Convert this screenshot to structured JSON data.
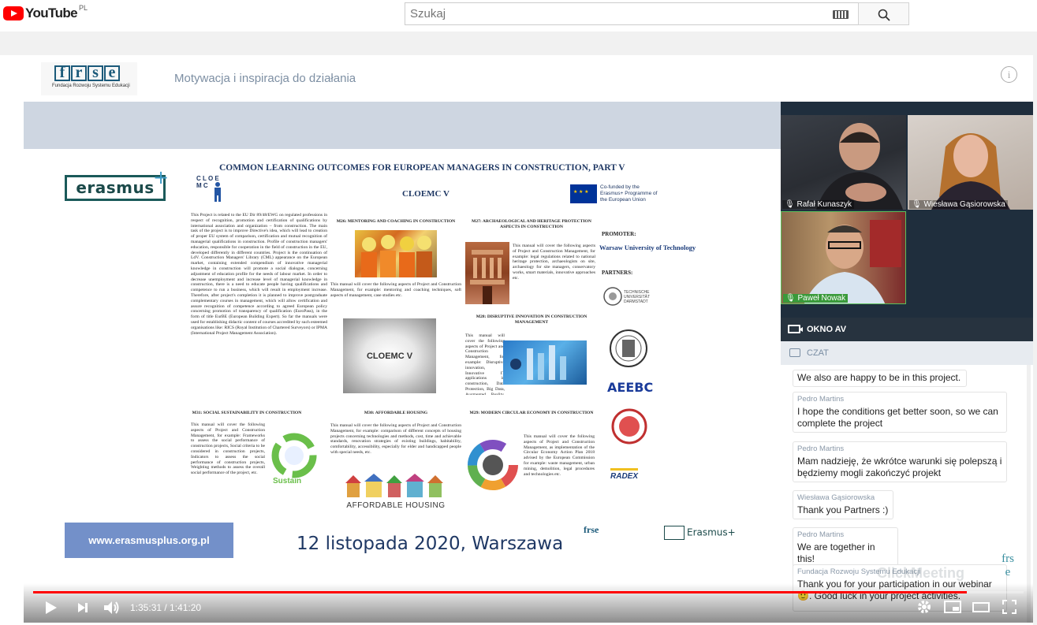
{
  "app": {
    "logo_text": "YouTube",
    "region": "PL"
  },
  "search": {
    "placeholder": "Szukaj"
  },
  "player": {
    "org_logo": "frse",
    "org_logo_sub": "Fundacja Rozwoju Systemu Edukacji",
    "title": "Motywacja i inspiracja do działania",
    "info_icon": "i"
  },
  "slide": {
    "erasmus_logo": "erasmus",
    "heading": "COMMON LEARNING OUTCOMES FOR EUROPEAN MANAGERS IN CONSTRUCTION, PART V",
    "project_logo": "C L O E M C",
    "project_name": "CLOEMC V",
    "cofunded": "Co-funded by the Erasmus+ Programme of the European Union",
    "promoter_label": "PROMOTER:",
    "promoter": "Warsaw University of Technology",
    "partners_label": "PARTNERS:",
    "partner_logos": [
      "TECHNISCHE UNIVERSITÄT DARMSTADT",
      "AEEBC",
      "RADEX"
    ],
    "intro_text": "This Project is related to the EU Dir 89/48/EWG on regulated professions in respect of recognition, promotion and certification of qualifications by international association and organization – from construction. The main task of the project is to improve Directive's idea, which will lead to creation of proper EU system of comparison, certification and mutual recognition of managerial qualifications in construction. Profile of construction managers' education, responsible for cooperation in the field of construction in the EU, developed differently in different countries. Project is the continuation of LdV. Construction Managers' Library (CML) appearance on the European market, containing extended compendium of innovative managerial knowledge in construction will promote a social dialogue, concerning adjustment of education profile for the needs of labour market. In order to decrease unemployment and increase level of managerial knowledge in construction, there is a need to educate people having qualifications and competence to run a business, which will result in employment increase. Therefore, after project's completion it is planned to improve postgraduate complementary courses in management, which will allow certification and assure recognition of competence according to agreed European policy concerning promotion of transparency of qualification (EuroPass), in the form of title EurBE (European Building Expert). So far the manuals were used for establishing didactic content of courses accredited by such esteemed organisations like: RICS (Royal Institution of Chartered Surveyors) or IPMA (International Project Management Association).",
    "m26_title": "M26: MENTORING AND COACHING IN CONSTRUCTION",
    "m26_text": "This manual will cover the following aspects of Project and Construction Management, for example: mentoring and coaching techniques, soft aspects of management, case studies etc.",
    "m27_title": "M27: ARCHAEOLOGICAL AND HERITAGE PROTECTION ASPECTS IN CONSTRUCTION",
    "m27_text": "This manual will cover the following aspects of Project and Construction Management, for example: legal regulations related to national heritage protection, archaeologists on site, archaeology for site managers, conservatory works, smart materials, innovative approaches etc.",
    "m28_title": "M28: DISRUPTIVE INNOVATION IN CONSTRUCTION MANAGEMENT",
    "m28_text": "This manual will cover the following aspects of Project and Construction Management, for example: Disruptive innovation, Innovative IT applications in construction, Data Protection, Big Data, Augmented Reality, etc.",
    "center_image_label": "CLOEMC V",
    "m31_title": "M31: SOCIAL SUSTAINABILITY IN CONSTRUCTION",
    "m31_text": "This manual will cover the following aspects of Project and Construction Management, for example: Frameworks to assess the social performance of construction projects, Social criteria to be considered in construction projects, Indicators to assess the social performance of construction projects, Weighting methods to assess the overall social performance of the project, etc.",
    "m30_title": "M30: AFFORDABLE HOUSING",
    "m30_text": "This manual will cover the following aspects of Project and Construction Management, for example: comparison of different concepts of housing projects concerning technologies and methods, cost, time and achievable standards, renovation strategies of existing buildings, habitability, comfortability, accessibility, especially for elder and handicapped people with special needs, etc.",
    "m30_image_label": "AFFORDABLE HOUSING",
    "m29_title": "M29: MODERN CIRCULAR ECONOMY IN CONSTRUCTION",
    "m29_text": "This manual will cover the following aspects of Project and Construction Management, as implementation of the Circular Economy Action Plan 2018 advised by the European Commission for example: waste management, urban mining, demolition, legal procedures and technologies etc.",
    "sustain_label": "Sustain",
    "link": "www.erasmusplus.org.pl",
    "date": "12 listopada 2020, Warszawa",
    "footer_frse": "frse",
    "footer_erasmus": "Erasmus+"
  },
  "cameras": [
    {
      "name": "Rafał Kunaszyk"
    },
    {
      "name": "Wiesława Gąsiorowska"
    },
    {
      "name": "Paweł Nowak"
    }
  ],
  "av_window": {
    "label": "OKNO AV"
  },
  "chat": {
    "label": "CZAT",
    "messages": [
      {
        "author": "",
        "text": "We also are happy to be in this project."
      },
      {
        "author": "Pedro Martins",
        "text": "I hope the conditions get better soon, so we can complete the project"
      },
      {
        "author": "Pedro Martins",
        "text": "Mam nadzieję, że wkrótce warunki się polepszą i będziemy mogli zakończyć projekt"
      },
      {
        "author": "Wiesława Gąsiorowska",
        "text": "Thank you Partners :)"
      },
      {
        "author": "Pedro Martins",
        "text": "We are together in this!"
      },
      {
        "author": "Fundacja Rozwoju Systemu Edukacji",
        "text": "Thank you for your participation in our webinar 🙂. Good luck in your project activities."
      }
    ],
    "watermark": "ClickMeeting",
    "logo": "frse"
  },
  "controls": {
    "current_time": "1:35:31",
    "duration": "1:41:20",
    "time_display": "1:35:31 / 1:41:20",
    "progress_fraction": 0.9425
  },
  "icons": {
    "play": "play-icon",
    "next": "next-icon",
    "volume": "volume-icon",
    "settings": "gear-icon",
    "miniplayer": "miniplayer-icon",
    "theater": "theater-icon",
    "fullscreen": "fullscreen-icon",
    "search": "search-icon",
    "keyboard": "keyboard-icon"
  }
}
